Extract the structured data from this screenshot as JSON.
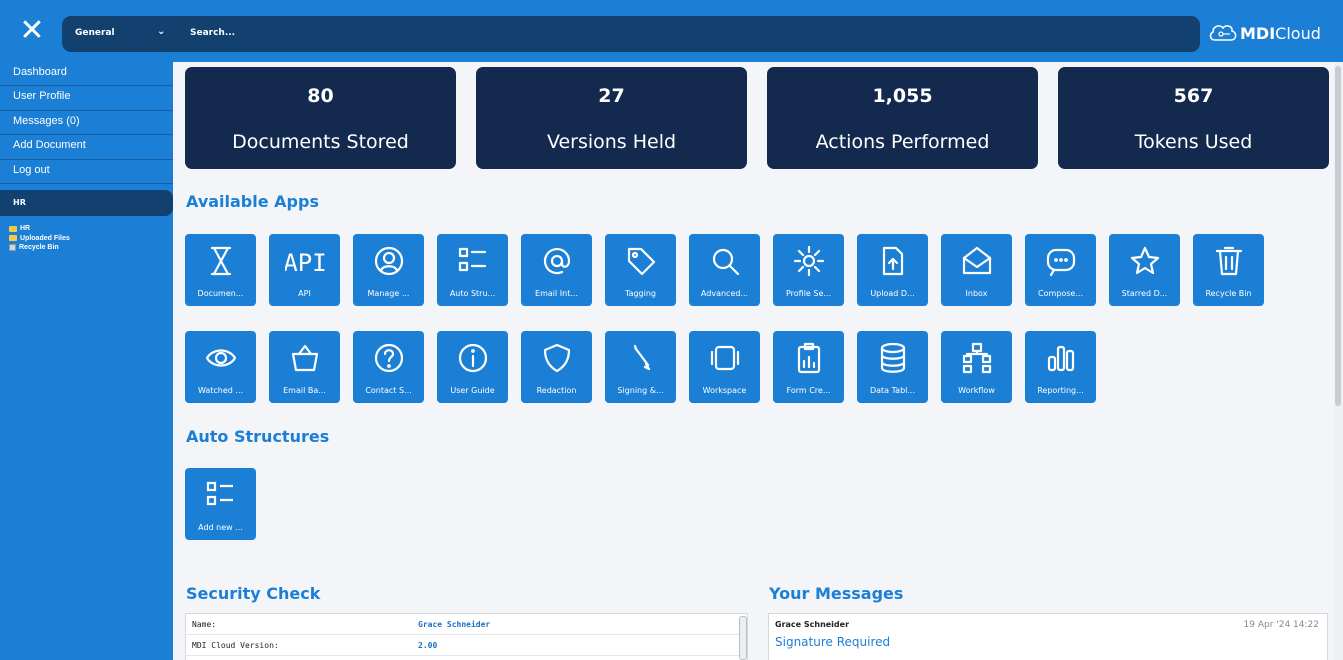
{
  "topbar": {
    "close_icon": "close-icon",
    "select_value": "General",
    "search_placeholder": "Search...",
    "logo_bold": "MDI",
    "logo_light": "Cloud"
  },
  "sidebar": {
    "items": [
      {
        "label": "Dashboard"
      },
      {
        "label": "User Profile"
      },
      {
        "label": "Messages (0)"
      },
      {
        "label": "Add Document"
      },
      {
        "label": "Log out"
      }
    ],
    "folder_header": "HR",
    "tree": [
      {
        "label": "HR",
        "icon": "folder-icon"
      },
      {
        "label": "Uploaded Files",
        "icon": "folder-icon"
      },
      {
        "label": "Recycle Bin",
        "icon": "recycle-bin-icon"
      }
    ]
  },
  "stats": [
    {
      "value": "80",
      "label": "Documents Stored"
    },
    {
      "value": "27",
      "label": "Versions Held"
    },
    {
      "value": "1,055",
      "label": "Actions Performed"
    },
    {
      "value": "567",
      "label": "Tokens Used"
    }
  ],
  "apps_title": "Available Apps",
  "apps": [
    {
      "label": "Documen...",
      "icon": "hourglass-icon"
    },
    {
      "label": "API",
      "icon": "api-icon"
    },
    {
      "label": "Manage ...",
      "icon": "user-circle-icon"
    },
    {
      "label": "Auto Stru...",
      "icon": "list-icon"
    },
    {
      "label": "Email Int...",
      "icon": "at-icon"
    },
    {
      "label": "Tagging",
      "icon": "tag-icon"
    },
    {
      "label": "Advanced...",
      "icon": "search-icon"
    },
    {
      "label": "Profile Se...",
      "icon": "gear-icon"
    },
    {
      "label": "Upload D...",
      "icon": "upload-icon"
    },
    {
      "label": "Inbox",
      "icon": "envelope-icon"
    },
    {
      "label": "Compose...",
      "icon": "chat-icon"
    },
    {
      "label": "Starred D...",
      "icon": "star-icon"
    },
    {
      "label": "Recycle Bin",
      "icon": "trash-icon"
    },
    {
      "label": "Watched ...",
      "icon": "eye-icon"
    },
    {
      "label": "Email Ba...",
      "icon": "basket-icon"
    },
    {
      "label": "Contact S...",
      "icon": "question-icon"
    },
    {
      "label": "User Guide",
      "icon": "info-icon"
    },
    {
      "label": "Redaction",
      "icon": "shield-icon"
    },
    {
      "label": "Signing &...",
      "icon": "pen-icon"
    },
    {
      "label": "Workspace",
      "icon": "tablet-icon"
    },
    {
      "label": "Form Cre...",
      "icon": "clipboard-icon"
    },
    {
      "label": "Data Tabl...",
      "icon": "database-icon"
    },
    {
      "label": "Workflow",
      "icon": "hierarchy-icon"
    },
    {
      "label": "Reporting...",
      "icon": "bar-chart-icon"
    }
  ],
  "auto_title": "Auto Structures",
  "auto_tile": {
    "label": "Add new ...",
    "icon": "list-icon"
  },
  "security": {
    "title": "Security Check",
    "rows": [
      {
        "key": "Name:",
        "value": "Grace Schneider"
      },
      {
        "key": "MDI Cloud Version:",
        "value": "2.00"
      }
    ]
  },
  "messages": {
    "title": "Your Messages",
    "sender": "Grace Schneider",
    "date": "19 Apr '24 14:22",
    "subject": "Signature Required"
  }
}
